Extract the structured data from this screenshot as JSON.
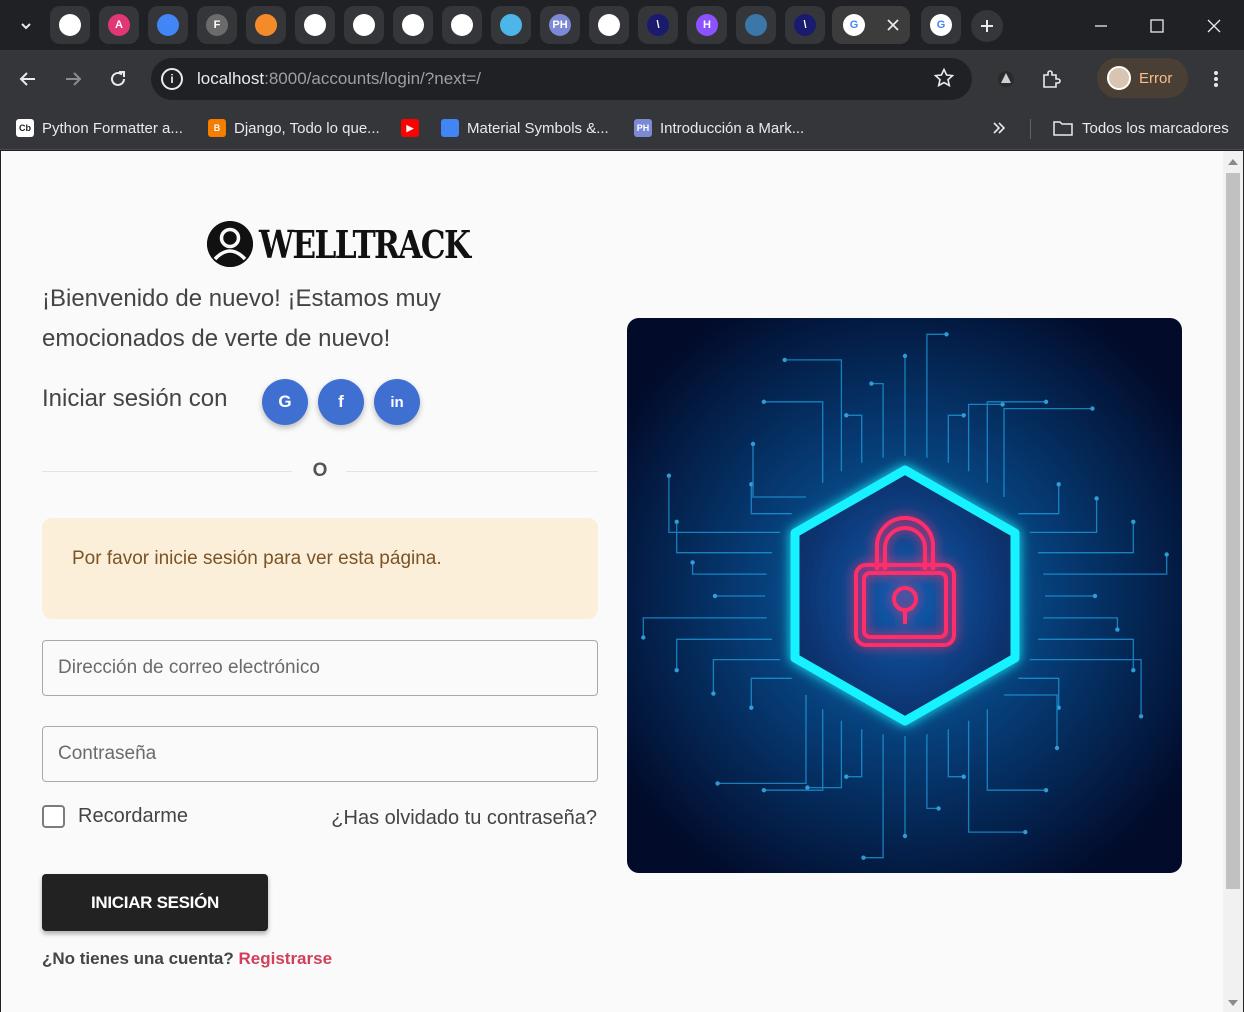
{
  "browser": {
    "tabs": [
      {
        "icon": "openai-icon",
        "color": "#ffffff",
        "glyph": ""
      },
      {
        "icon": "angular-icon",
        "color": "#e23775",
        "glyph": "A"
      },
      {
        "icon": "material-symbols-icon",
        "color": "#4285f4",
        "glyph": ""
      },
      {
        "icon": "f-icon",
        "color": "#6b6b6b",
        "glyph": "F"
      },
      {
        "icon": "brave-icon",
        "color": "#f48b2b",
        "glyph": ""
      },
      {
        "icon": "github-icon",
        "color": "#ffffff",
        "glyph": ""
      },
      {
        "icon": "github-icon",
        "color": "#ffffff",
        "glyph": ""
      },
      {
        "icon": "github-icon",
        "color": "#ffffff",
        "glyph": ""
      },
      {
        "icon": "github-icon",
        "color": "#ffffff",
        "glyph": ""
      },
      {
        "icon": "globe-icon",
        "color": "#4db6e8",
        "glyph": ""
      },
      {
        "icon": "ph-icon",
        "color": "#7c8ad6",
        "glyph": "PH"
      },
      {
        "icon": "github-icon",
        "color": "#ffffff",
        "glyph": ""
      },
      {
        "icon": "slash-icon",
        "color": "#1a1a6e",
        "glyph": "\\"
      },
      {
        "icon": "h-icon",
        "color": "#8c52ff",
        "glyph": "H"
      },
      {
        "icon": "python-icon",
        "color": "#3b77a8",
        "glyph": ""
      },
      {
        "icon": "slash-icon",
        "color": "#1a1a6e",
        "glyph": "\\"
      },
      {
        "icon": "google-icon",
        "color": "#ffffff",
        "glyph": "G"
      },
      {
        "icon": "google-icon",
        "color": "#ffffff",
        "glyph": "G"
      }
    ],
    "url_host": "localhost",
    "url_rest": ":8000/accounts/login/?next=/",
    "profile_status": "Error",
    "bookmarks": [
      {
        "label": "Python Formatter a...",
        "icon": "cb-icon",
        "color": "#ffffff",
        "glyph": "Cb"
      },
      {
        "label": "Django, Todo lo que...",
        "icon": "blogger-icon",
        "color": "#f57d00",
        "glyph": "B"
      },
      {
        "label": "",
        "icon": "youtube-icon",
        "color": "#ff0000",
        "glyph": "▶"
      },
      {
        "label": "Material Symbols &...",
        "icon": "material-symbols-icon",
        "color": "#4285f4",
        "glyph": ""
      },
      {
        "label": "Introducción a Mark...",
        "icon": "ph-icon",
        "color": "#7c8ad6",
        "glyph": "PH"
      }
    ],
    "all_bookmarks": "Todos los marcadores"
  },
  "page": {
    "brand": "WELLTRACK",
    "welcome": "¡Bienvenido de nuevo! ¡Estamos muy emocionados de verte de nuevo!",
    "signin_with": "Iniciar sesión con",
    "social": [
      {
        "name": "google",
        "glyph": "G"
      },
      {
        "name": "facebook",
        "glyph": "f"
      },
      {
        "name": "linkedin",
        "glyph": "in"
      }
    ],
    "or": "O",
    "alert": "Por favor inicie sesión para ver esta página.",
    "email_placeholder": "Dirección de correo electrónico",
    "password_placeholder": "Contraseña",
    "remember": "Recordarme",
    "forgot": "¿Has olvidado tu contraseña?",
    "submit": "INICIAR SESIÓN",
    "no_account": "¿No tienes una cuenta?",
    "register": "Registrarse"
  }
}
